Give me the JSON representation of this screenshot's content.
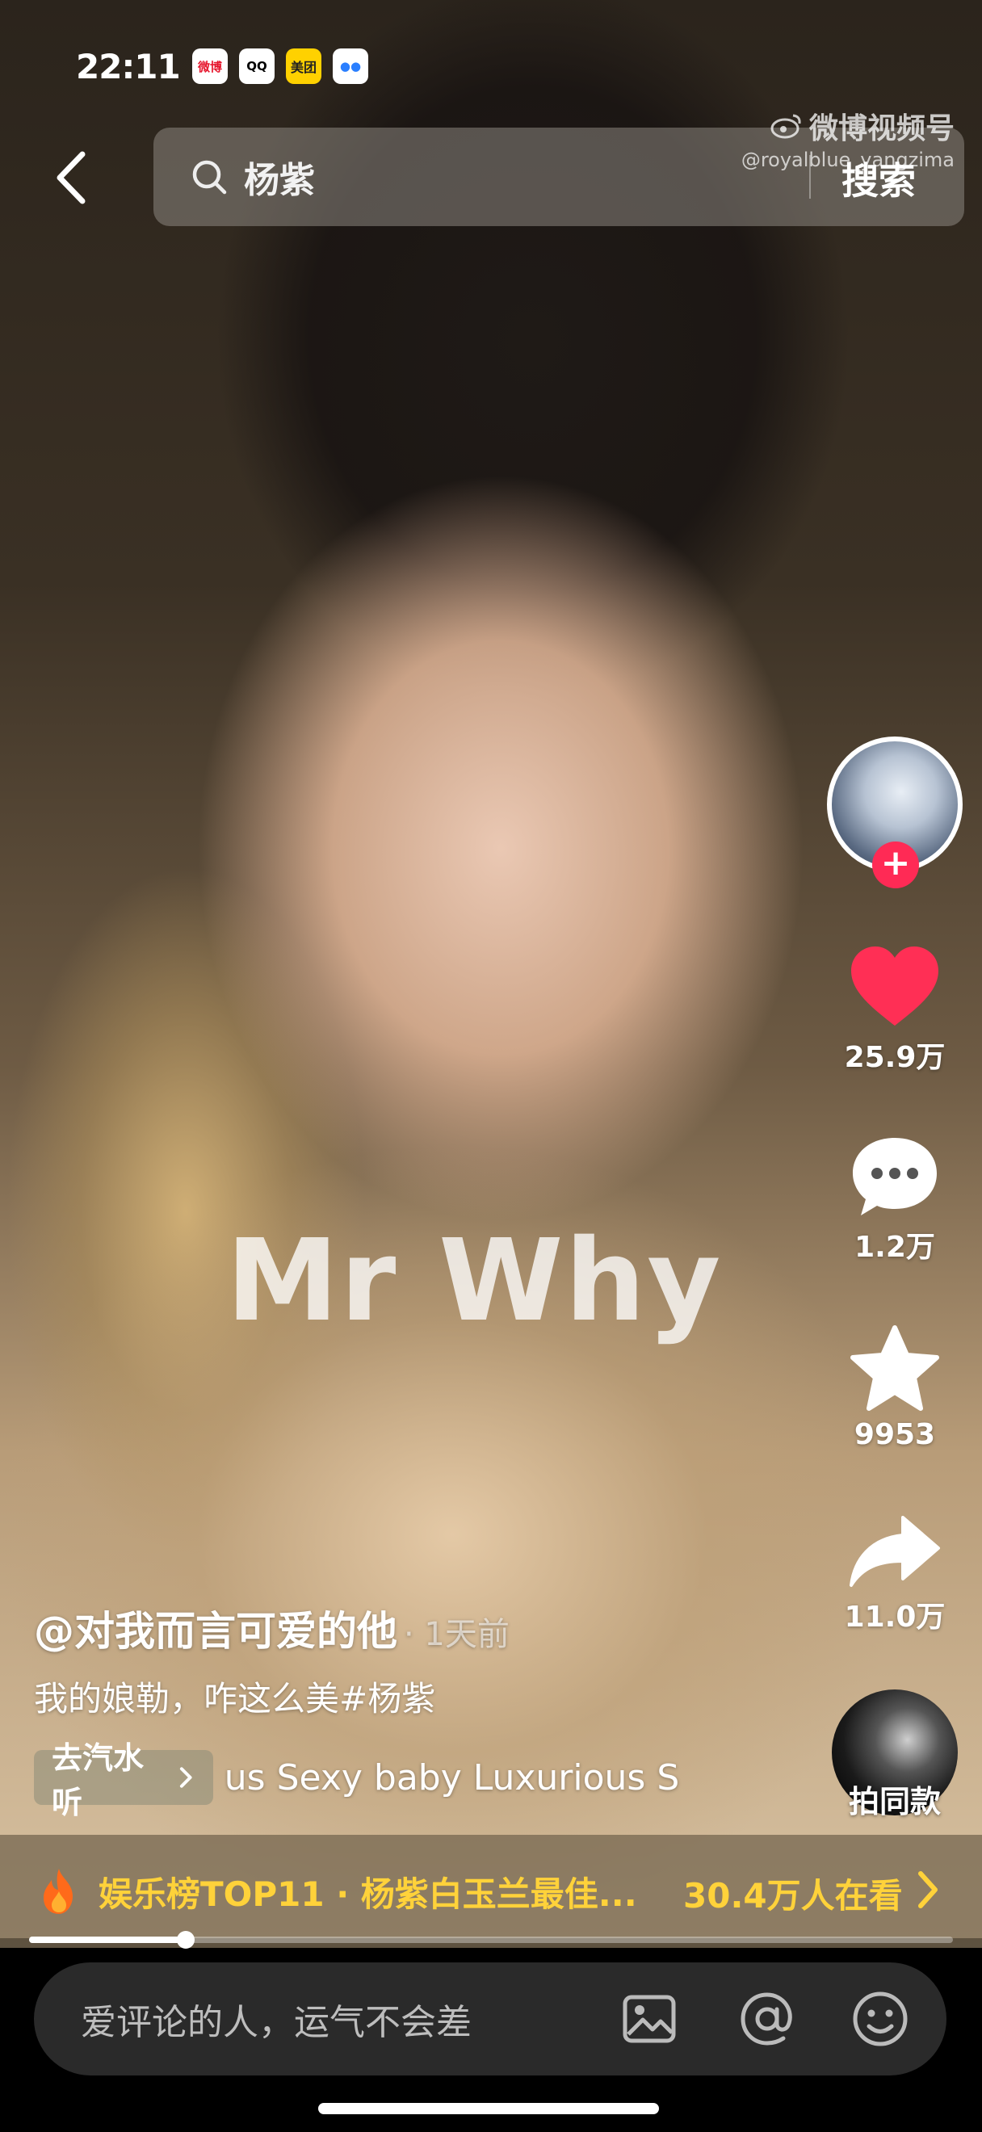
{
  "status_bar": {
    "time": "22:11",
    "apps": [
      {
        "icon": "weibo-icon",
        "label": "微博"
      },
      {
        "icon": "qq-icon",
        "label": "QQ"
      },
      {
        "icon": "meituan-icon",
        "label": "美团"
      },
      {
        "icon": "app-icon",
        "label": "●●"
      }
    ]
  },
  "search": {
    "query": "杨紫",
    "button_label": "搜索"
  },
  "watermark": {
    "brand": "微博视频号",
    "handle": "@royalblue_yangzima"
  },
  "video_overlay_text": "Mr Why",
  "actions": {
    "likes": "25.9万",
    "comments": "1.2万",
    "favorites": "9953",
    "shares": "11.0万",
    "same_style_label": "拍同款"
  },
  "post": {
    "author": "@对我而言可爱的他",
    "time": "· 1天前",
    "description": "我的娘勒，咋这么美#杨紫",
    "music_chip": "去汽水听",
    "music_title": "us Sexy baby    Luxurious S"
  },
  "trending": {
    "text": "娱乐榜TOP11 · 杨紫白玉兰最佳...",
    "viewers": "30.4万人在看"
  },
  "playback": {
    "progress": 0.17
  },
  "comment_bar": {
    "placeholder": "爱评论的人，运气不会差"
  },
  "colors": {
    "like": "#ff2f55",
    "trending_text": "#ffd23a",
    "follow": "#ff2a55"
  }
}
